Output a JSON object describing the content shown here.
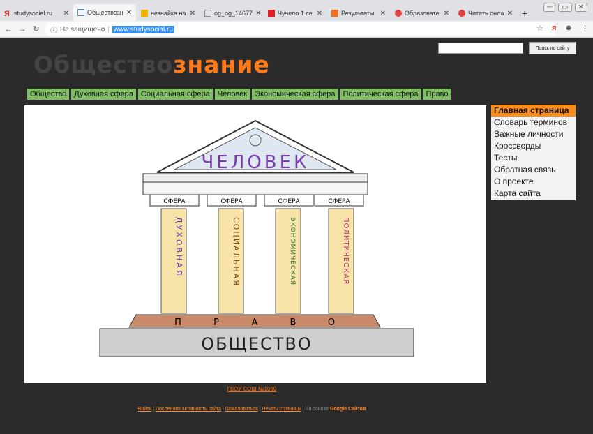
{
  "browser": {
    "tabs": [
      {
        "label": "studysocial.ru",
        "color": "#d9322b"
      },
      {
        "label": "Обществозн",
        "color": "#4a90d9"
      },
      {
        "label": "незнайка на",
        "color": "#f0b400"
      },
      {
        "label": "og_og_14677",
        "color": "#888888"
      },
      {
        "label": "Чучело 1 се",
        "color": "#e02020"
      },
      {
        "label": "Результаты",
        "color": "#f07020"
      },
      {
        "label": "Образовате",
        "color": "#e04040"
      },
      {
        "label": "Читать онла",
        "color": "#e04040"
      }
    ],
    "new_tab": "+",
    "not_secure": "Не защищено",
    "url": "www.studysocial.ru"
  },
  "site": {
    "logo_dark": "Обществознание",
    "logo_a": "Общество",
    "logo_b": "знание",
    "search_button": "Поиск по сайту",
    "menu": [
      "Общество",
      "Духовная сфера",
      "Социальная сфера",
      "Человек",
      "Экономическая сфера",
      "Политическая сфера",
      "Право"
    ],
    "side": [
      "Главная страница",
      "Словарь терминов",
      "Важные личности",
      "Кроссворды",
      "Тесты",
      "Обратная связь",
      "О проекте",
      "Карта сайта"
    ],
    "drawing": {
      "roof": "ЧЕЛОВЕК",
      "column_label": "СФЕРА",
      "columns": [
        "ДУХОВНАЯ",
        "СОЦИАЛЬНАЯ",
        "ЭКОНОМИЧЕСКАЯ",
        "ПОЛИТИЧЕСКАЯ"
      ],
      "base": [
        "П",
        "Р",
        "А",
        "В",
        "О"
      ],
      "foundation": "ОБЩЕСТВО"
    },
    "footer_school": "ГБОУ СОШ №1060",
    "footer_links": [
      "Войти",
      "Последняя активность сайта",
      "Пожаловаться",
      "Печать страницы"
    ],
    "footer_tail": "На основе",
    "footer_brand": "Google Сайтов"
  }
}
